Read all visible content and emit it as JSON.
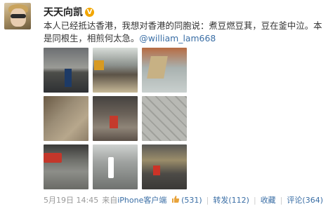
{
  "user": {
    "name": "天天向凯",
    "verified_badge": "V"
  },
  "post": {
    "text": "本人已经抵达香港，我想对香港的同胞说：煮豆燃豆萁，豆在釜中泣。本是同根生，相煎何太急。",
    "mention": "@william_lam668"
  },
  "photos": [
    "street-photo-1",
    "street-photo-2",
    "street-photo-3",
    "street-photo-4",
    "street-photo-5",
    "street-photo-6",
    "street-photo-7",
    "street-photo-8",
    "street-photo-9"
  ],
  "footer": {
    "date": "5月19日 14:45",
    "via": "来自",
    "client": "iPhone客户端"
  },
  "actions": {
    "like_count": "(531)",
    "repost": "转发(112)",
    "favorite": "收藏",
    "comment": "评论(364)"
  }
}
